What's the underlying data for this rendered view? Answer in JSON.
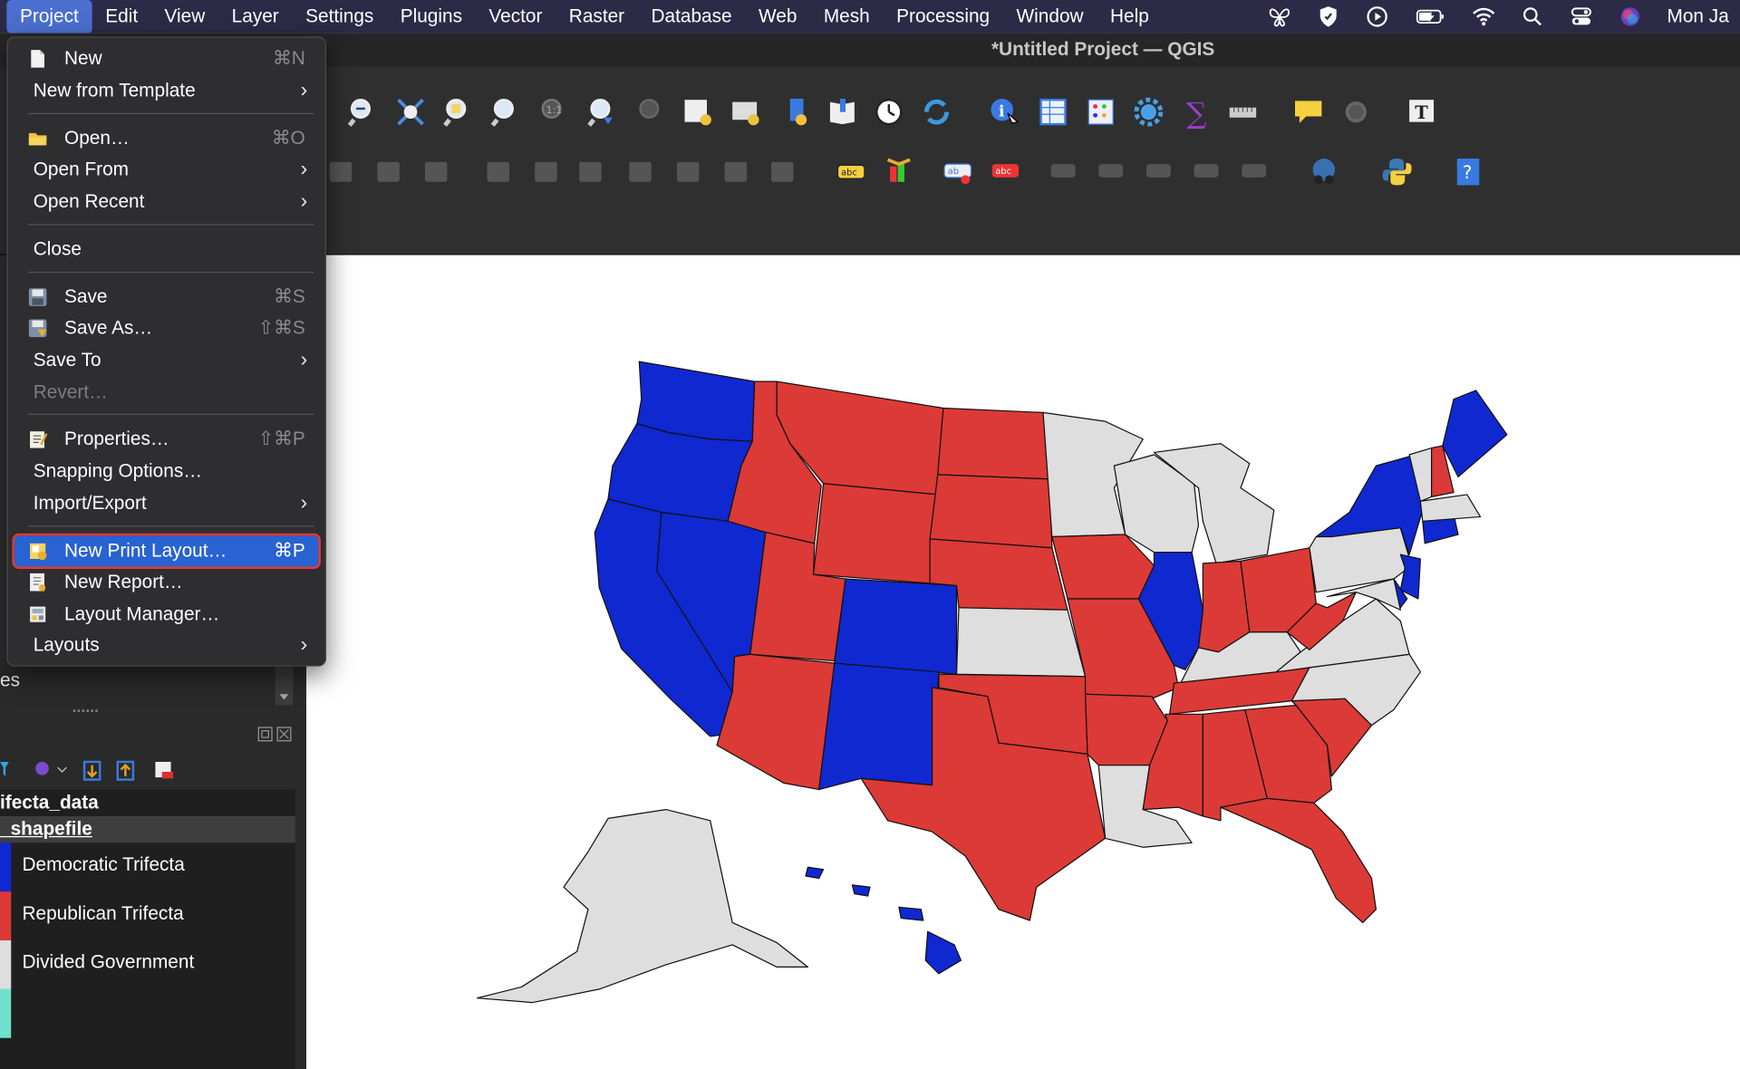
{
  "menubar": {
    "apple_items": [
      "Project",
      "Edit",
      "View",
      "Layer",
      "Settings",
      "Plugins",
      "Vector",
      "Raster",
      "Database",
      "Web",
      "Mesh",
      "Processing",
      "Window",
      "Help"
    ],
    "active_item": "Project",
    "clock": "Mon Ja",
    "status_icons": [
      "butterfly-icon",
      "shield-icon",
      "play-circle-icon",
      "battery-icon",
      "wifi-icon",
      "search-icon",
      "control-center-icon",
      "siri-icon"
    ]
  },
  "window": {
    "title": "*Untitled Project — QGIS"
  },
  "project_menu": {
    "items": [
      {
        "label": "New",
        "shortcut": "⌘N",
        "icon": "new-file-icon"
      },
      {
        "label": "New from Template",
        "submenu": true
      },
      {
        "label": "Open…",
        "shortcut": "⌘O",
        "icon": "open-folder-icon"
      },
      {
        "label": "Open From",
        "submenu": true
      },
      {
        "label": "Open Recent",
        "submenu": true
      },
      {
        "label": "Close"
      },
      {
        "label": "Save",
        "shortcut": "⌘S",
        "icon": "save-icon"
      },
      {
        "label": "Save As…",
        "shortcut": "⇧⌘S",
        "icon": "save-as-icon"
      },
      {
        "label": "Save To",
        "submenu": true
      },
      {
        "label": "Revert…",
        "disabled": true
      },
      {
        "label": "Properties…",
        "shortcut": "⇧⌘P",
        "icon": "properties-icon"
      },
      {
        "label": "Snapping Options…"
      },
      {
        "label": "Import/Export",
        "submenu": true
      },
      {
        "label": "New Print Layout…",
        "shortcut": "⌘P",
        "icon": "new-print-layout-icon",
        "highlighted": true
      },
      {
        "label": "New Report…",
        "icon": "new-report-icon"
      },
      {
        "label": "Layout Manager…",
        "icon": "layout-manager-icon"
      },
      {
        "label": "Layouts",
        "submenu": true
      }
    ]
  },
  "layers_panel": {
    "partial_label": "es",
    "layers": [
      "ifecta_data",
      "_shapefile"
    ],
    "legend": [
      {
        "label": "Democratic Trifecta",
        "color": "#1028d0"
      },
      {
        "label": "Republican Trifecta",
        "color": "#dc3a36"
      },
      {
        "label": "Divided Government",
        "color": "#dedede"
      },
      {
        "label": "",
        "color": "#6ee0cc"
      }
    ]
  },
  "map": {
    "colors": {
      "dem": "#1028d0",
      "rep": "#dc3a36",
      "div": "#dedede"
    }
  }
}
